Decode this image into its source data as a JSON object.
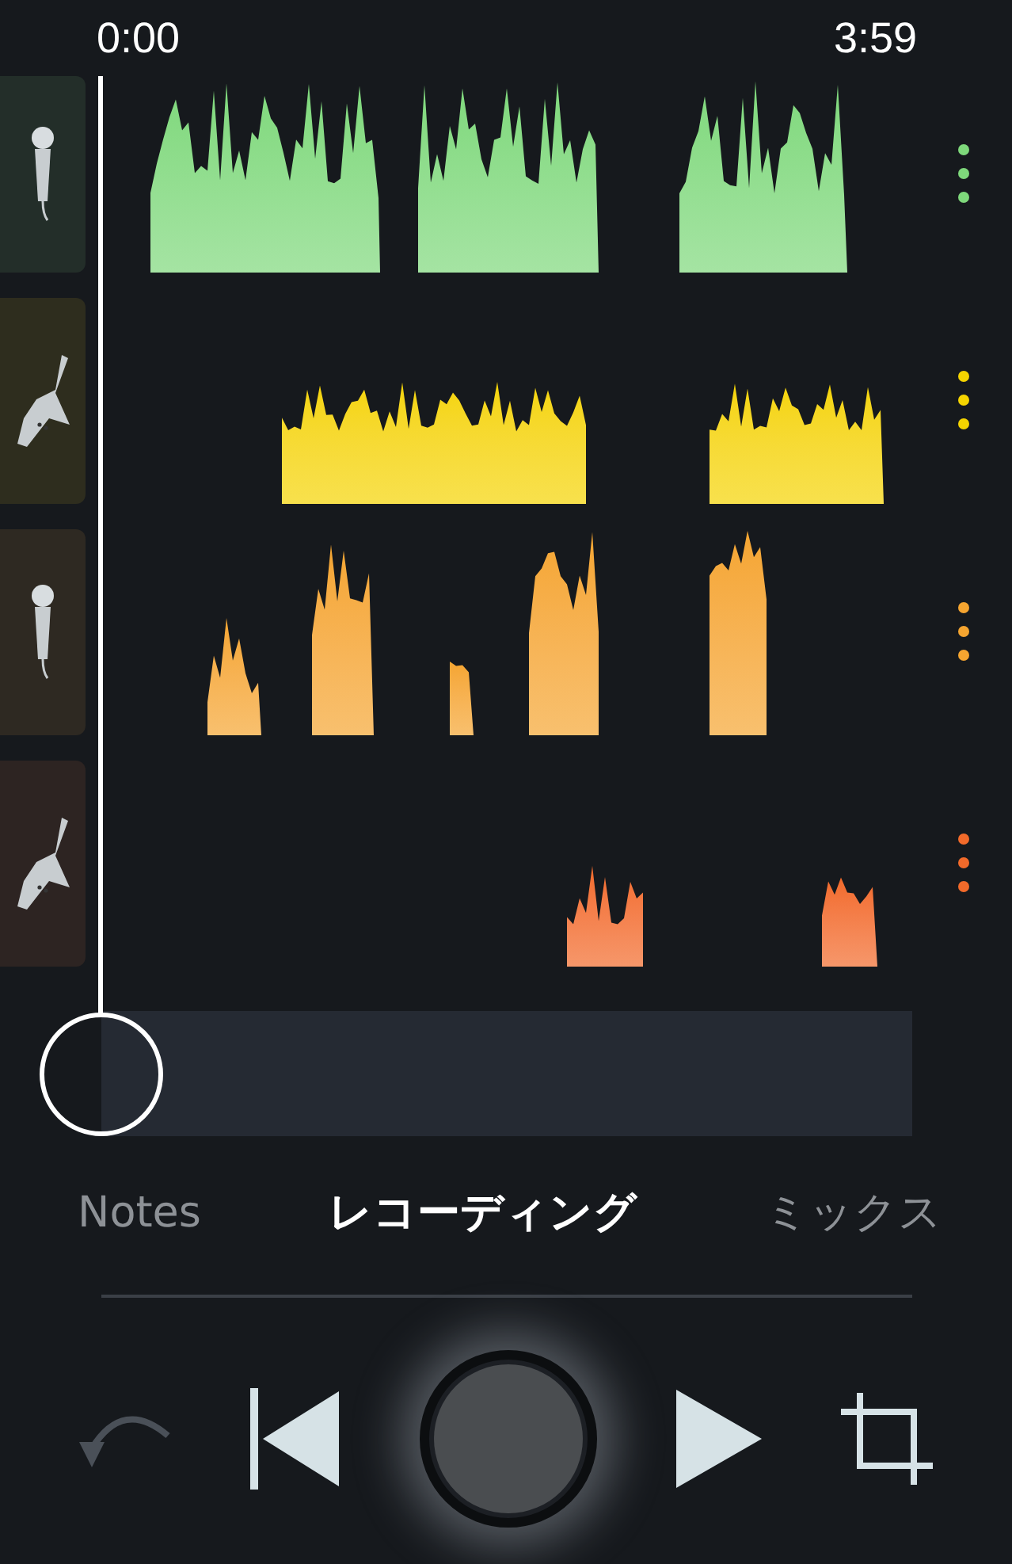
{
  "header": {
    "start_time": "0:00",
    "end_time": "3:59"
  },
  "tracks": [
    {
      "kind": "microphone",
      "color": "#7ed87b"
    },
    {
      "kind": "guitar",
      "color": "#f5d400"
    },
    {
      "kind": "microphone",
      "color": "#f5a530"
    },
    {
      "kind": "guitar",
      "color": "#f26a2a"
    }
  ],
  "tabs": [
    {
      "label": "Notes",
      "selected": false
    },
    {
      "label": "レコーディング",
      "selected": true
    },
    {
      "label": "ミックス",
      "selected": false
    }
  ],
  "controls": [
    {
      "kind": "undo",
      "disabled": true
    },
    {
      "kind": "skip_back",
      "disabled": false
    },
    {
      "kind": "record",
      "disabled": false
    },
    {
      "kind": "play",
      "disabled": false
    },
    {
      "kind": "crop",
      "disabled": false
    }
  ]
}
